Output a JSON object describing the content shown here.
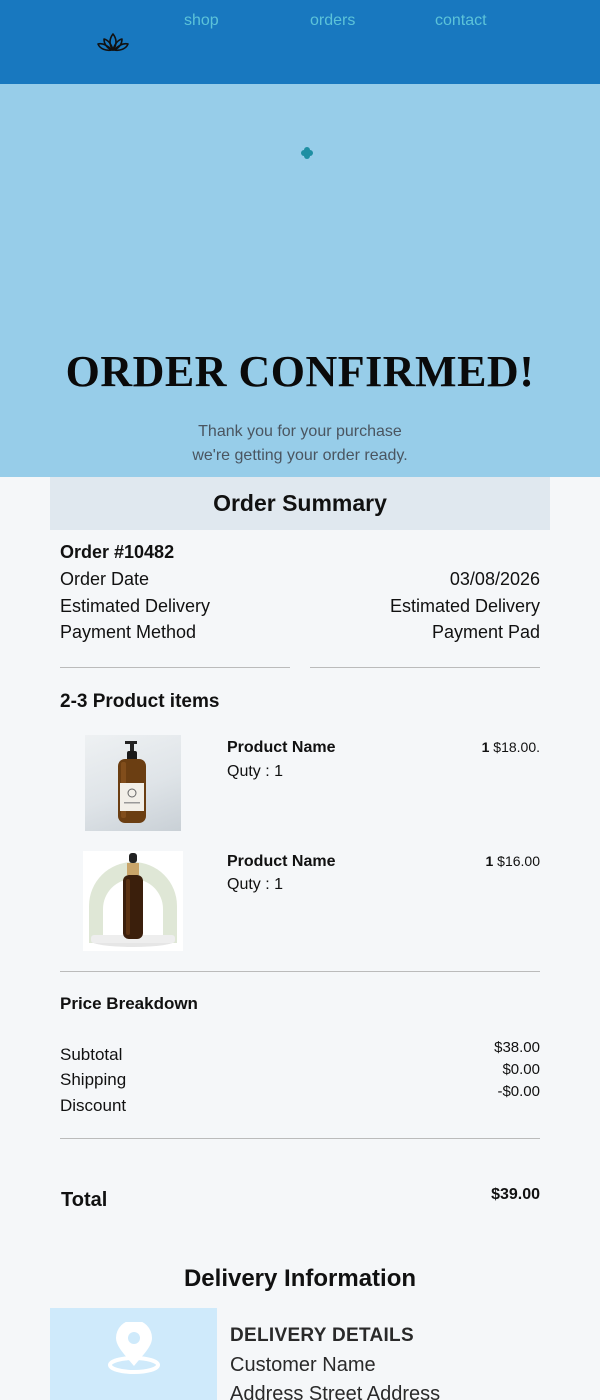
{
  "nav": {
    "logo_icon": "lotus-icon",
    "links": [
      "shop",
      "orders",
      "contact"
    ]
  },
  "hero": {
    "icon": "flower-icon",
    "title": "ORDER CONFIRMED!",
    "subtitle_line1": "Thank you for your purchase",
    "subtitle_line2": "we're getting your order ready."
  },
  "summary": {
    "heading": "Order Summary",
    "order_number": "Order #10482",
    "rows": [
      {
        "label": "Order Date",
        "value": "03/08/2026"
      },
      {
        "label": "Estimated Delivery",
        "value": "Estimated Delivery"
      },
      {
        "label": "Payment Method",
        "value": "Payment Pad"
      }
    ]
  },
  "items": {
    "heading": "2-3 Product items",
    "list": [
      {
        "name": "Product Name",
        "qty_label": "Quty : 1",
        "count": "1",
        "price": "$18.00.",
        "image": "amber-pump-bottle"
      },
      {
        "name": "Product Name",
        "qty_label": "Quty : 1",
        "count": "1",
        "price": "$16.00",
        "image": "amber-dropper-bottle"
      }
    ]
  },
  "price_breakdown": {
    "heading": "Price Breakdown",
    "labels": [
      "Subtotal",
      "Shipping",
      "Discount"
    ],
    "values": [
      "$38.00",
      "$0.00",
      "-$0.00"
    ]
  },
  "total": {
    "label": "Total",
    "value": "$39.00"
  },
  "delivery": {
    "heading": "Delivery Information",
    "icon": "location-pin-icon",
    "details_title": "DELIVERY DETAILS",
    "customer_name": "Customer Name",
    "address": "Address Street Address"
  },
  "colors": {
    "topbar": "#1878bf",
    "nav_link": "#5cc3d9",
    "hero": "#97cde9",
    "summary_header": "#e0e8ef",
    "delivery_box": "#cfeafb"
  }
}
